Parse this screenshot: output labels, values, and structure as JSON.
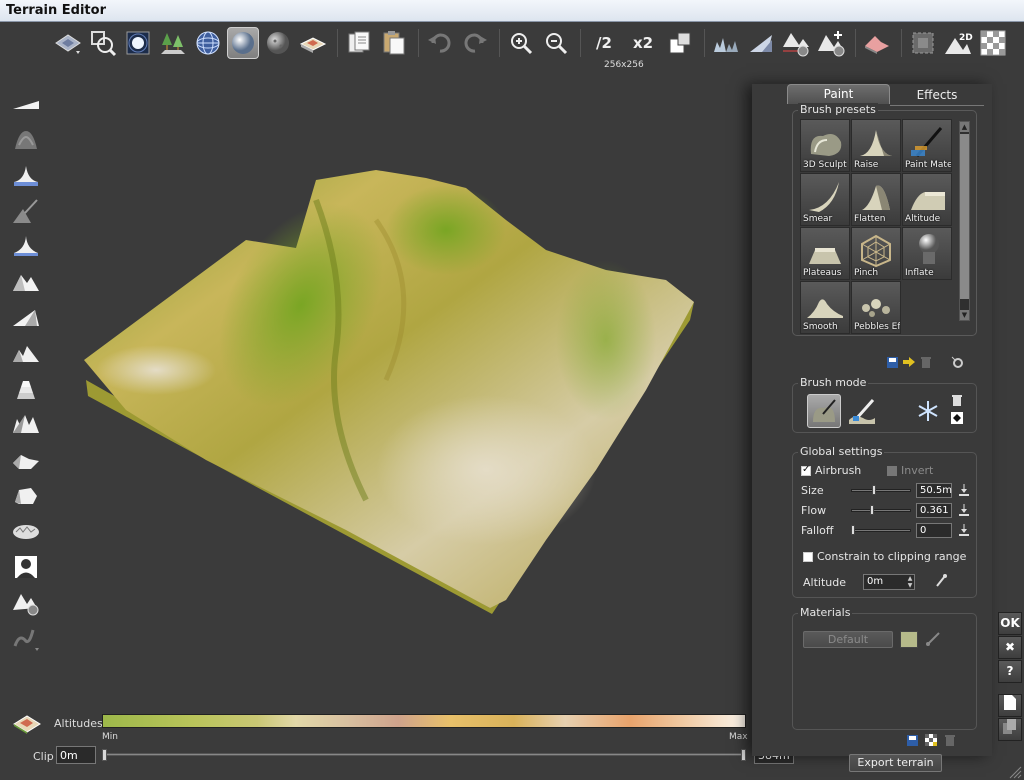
{
  "window": {
    "title": "Terrain Editor"
  },
  "toolbar": {
    "tools": [
      "terrain-view-icon",
      "zoom-selection-icon",
      "light-icon",
      "trees-icon",
      "sphere-wireframe-icon",
      "sphere-shaded-icon",
      "sphere-rock-icon",
      "terrain-textured-icon",
      "copy-icon",
      "paste-icon",
      "undo-icon",
      "redo-icon",
      "zoom-in-icon",
      "zoom-out-icon"
    ],
    "half_label": "/2",
    "double_label": "x2",
    "resolution_label": "256x256"
  },
  "viewport": {
    "colors": {
      "grass": "#7ea12a",
      "sand": "#c7b55b",
      "rock": "#d8d0b4",
      "side": "#9d9a33"
    }
  },
  "altitudes": {
    "label": "Altitudes",
    "min_label": "Min",
    "max_label": "Max",
    "clip_label": "Clip",
    "clip_min_value": "0m",
    "clip_max_value": "384m"
  },
  "panel": {
    "tabs": {
      "paint": "Paint",
      "effects": "Effects"
    },
    "presets": {
      "title": "Brush presets",
      "items": [
        {
          "label": "3D Sculpt"
        },
        {
          "label": "Raise"
        },
        {
          "label": "Paint Mater"
        },
        {
          "label": "Smear"
        },
        {
          "label": "Flatten"
        },
        {
          "label": "Altitude"
        },
        {
          "label": "Plateaus"
        },
        {
          "label": "Pinch"
        },
        {
          "label": "Inflate"
        },
        {
          "label": "Smooth"
        },
        {
          "label": "Pebbles Eff"
        }
      ]
    },
    "brush_mode": {
      "title": "Brush mode"
    },
    "global": {
      "title": "Global settings",
      "airbrush_label": "Airbrush",
      "invert_label": "Invert",
      "size_label": "Size",
      "size_value": "50.5m",
      "flow_label": "Flow",
      "flow_value": "0.361",
      "falloff_label": "Falloff",
      "falloff_value": "0",
      "constrain_label": "Constrain to clipping range",
      "altitude_label": "Altitude",
      "altitude_value": "0m"
    },
    "materials": {
      "title": "Materials",
      "default_label": "Default"
    },
    "export_label": "Export terrain"
  },
  "side_buttons": {
    "ok": "OK",
    "cancel": "✖",
    "help": "?"
  }
}
